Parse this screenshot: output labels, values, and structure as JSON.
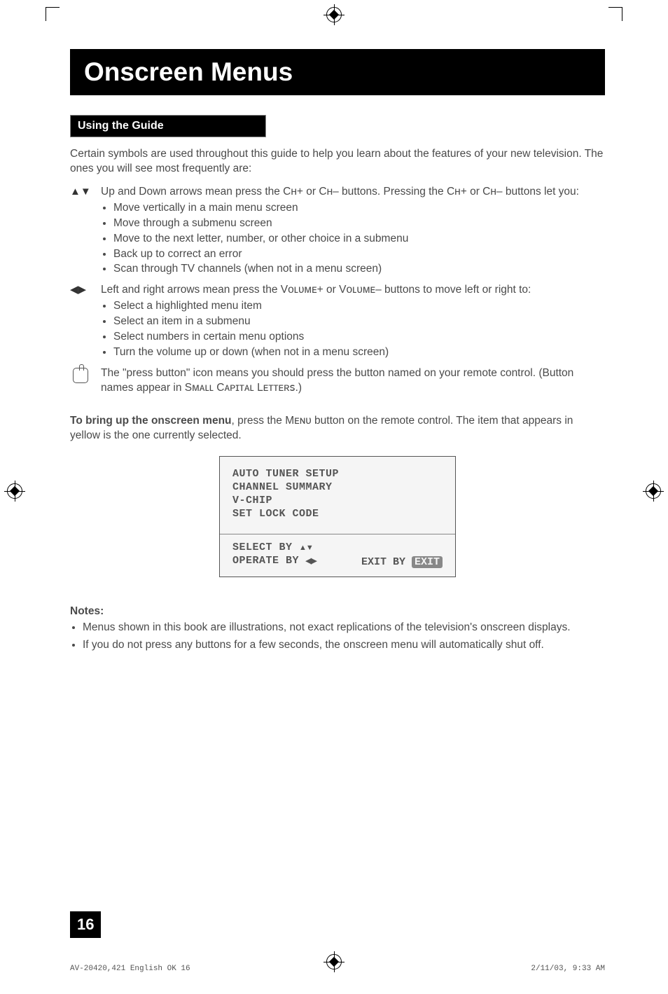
{
  "title": "Onscreen Menus",
  "subhead": "Using the Guide",
  "intro": "Certain symbols are used throughout this guide to help you learn about the features of your new television. The ones you will see most frequently are:",
  "items": [
    {
      "symbol": "▲▼",
      "lead": "Up and Down arrows mean press the Cʜ+ or Cʜ– buttons. Pressing the Cʜ+ or Cʜ– buttons let you:",
      "bullets": [
        "Move vertically in a main menu screen",
        "Move through a submenu screen",
        "Move to the next letter, number, or other choice in a submenu",
        "Back up to correct an error",
        "Scan through TV channels (when not in a menu screen)"
      ]
    },
    {
      "symbol": "◀▶",
      "lead": "Left and right arrows mean press the Vᴏʟᴜᴍᴇ+ or Vᴏʟᴜᴍᴇ– buttons to move left or right to:",
      "bullets": [
        "Select a highlighted menu item",
        "Select an item in a submenu",
        "Select numbers in certain menu options",
        "Turn the volume up or down (when not in a menu screen)"
      ]
    }
  ],
  "press_lead": "The \"press button\" icon means you should press the button named on your remote control. (Button names appear in Sᴍᴀʟʟ Cᴀᴘɪᴛᴀʟ Lᴇᴛᴛᴇʀꜱ.)",
  "bring_up_bold": "To bring up the onscreen menu",
  "bring_up_rest": ", press the Mᴇɴᴜ button on the remote control. The item that appears in yellow is the one currently selected.",
  "menu": {
    "lines": [
      "AUTO TUNER SETUP",
      "CHANNEL SUMMARY",
      "V-CHIP",
      "SET LOCK CODE"
    ],
    "select": "SELECT  BY",
    "operate": "OPERATE BY",
    "exit_by": "EXIT BY",
    "exit_key": "EXIT"
  },
  "notes_h": "Notes:",
  "notes": [
    "Menus shown in this book are illustrations, not exact replications of the television's onscreen displays.",
    "If you do not press any buttons for a few seconds, the onscreen menu will automatically shut off."
  ],
  "page_num": "16",
  "footer_left": "AV-20420,421 English OK   16",
  "footer_right": "2/11/03, 9:33 AM"
}
